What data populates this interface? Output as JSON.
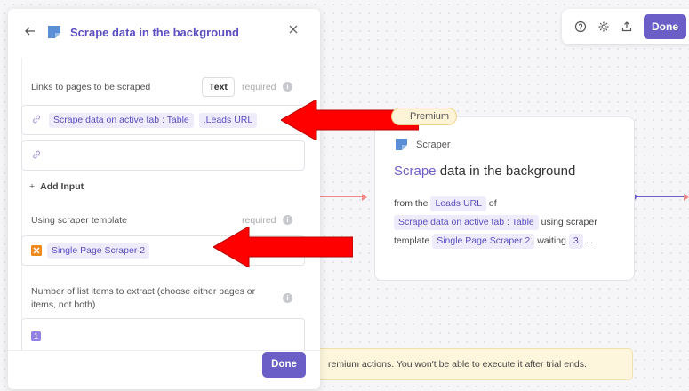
{
  "toolbar": {
    "help_icon": "help-icon",
    "settings_icon": "gear-icon",
    "share_icon": "share-icon",
    "done_label": "Done"
  },
  "node": {
    "premium_label": "Premium",
    "type_label": "Scraper",
    "title_accent": "Scrape",
    "title_rest": " data in the background",
    "desc_from": "from the",
    "desc_leads_chip": "Leads URL",
    "desc_of": "of",
    "desc_table_chip": "Scrape data on active tab : Table",
    "desc_using": "using scraper",
    "desc_template": "template",
    "desc_scraper_chip": "Single Page Scraper 2",
    "desc_waiting": "waiting",
    "desc_wait_chip": "3",
    "desc_ellipsis": "..."
  },
  "banner": {
    "text": "remium actions. You won't be able to execute it after trial ends."
  },
  "panel": {
    "title": "Scrape data in the background",
    "links_label": "Links to pages to be scraped",
    "links_type": "Text",
    "required": "required",
    "link_chip_table": "Scrape data on active tab : Table",
    "link_chip_leads": ".Leads URL",
    "add_input": "Add Input",
    "template_label": "Using scraper template",
    "template_value": "Single Page Scraper 2",
    "items_label": "Number of list items to extract (choose either pages or items, not both)",
    "items_value": "1",
    "done_label": "Done"
  },
  "colors": {
    "accent": "#6b5fc7",
    "annotation_arrow": "#ff0000",
    "premium_bg": "#fdf3d6",
    "banner_bg": "#fdf6dc"
  }
}
